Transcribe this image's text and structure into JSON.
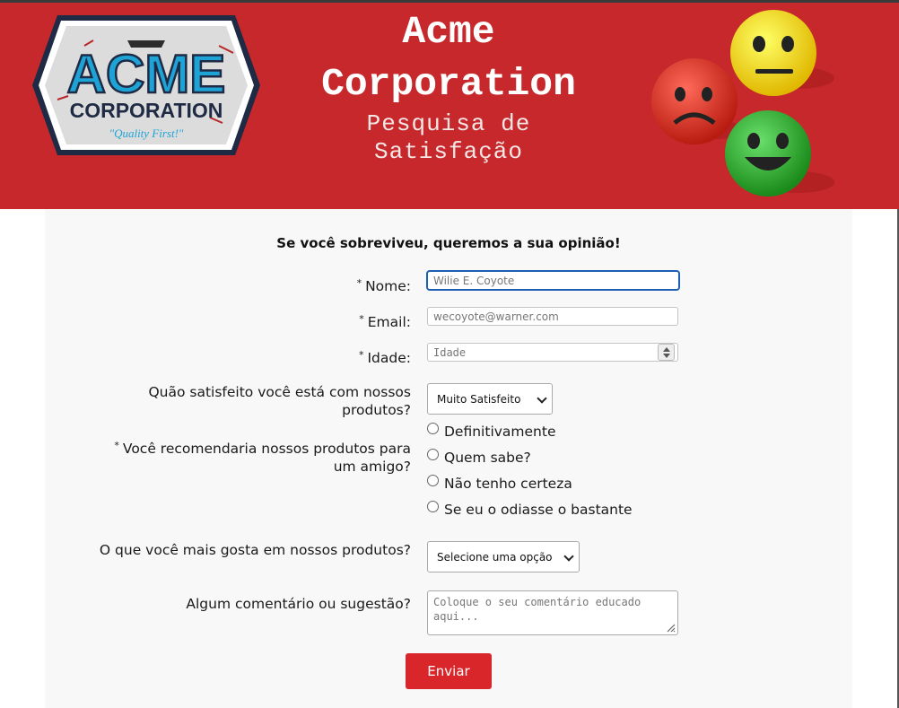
{
  "header": {
    "title_line1": "Acme",
    "title_line2": "Corporation",
    "subtitle_line1": "Pesquisa de",
    "subtitle_line2": "Satisfação",
    "logo": {
      "line1": "ACME",
      "line2": "CORPORATION",
      "tagline": "\"Quality First!\""
    },
    "colors": {
      "header_bg": "#c6282b",
      "button": "#d9262b",
      "focus": "#1d5fb5"
    }
  },
  "form": {
    "heading": "Se você sobreviveu, queremos a sua opinião!",
    "required_mark": "*",
    "name": {
      "label": "Nome:",
      "placeholder": "Wilie E. Coyote"
    },
    "email": {
      "label": "Email:",
      "placeholder": "wecoyote@warner.com"
    },
    "age": {
      "label": "Idade:",
      "placeholder": "Idade"
    },
    "satisfaction": {
      "label_line1": "Quão satisfeito você está com nossos",
      "label_line2": "produtos?",
      "selected": "Muito Satisfeito"
    },
    "recommend": {
      "label_line1": "Você recomendaria nossos produtos para",
      "label_line2": "um amigo?",
      "options": [
        "Definitivamente",
        "Quem sabe?",
        "Não tenho certeza",
        "Se eu o odiasse o bastante"
      ]
    },
    "likes": {
      "label": "O que você mais gosta em nossos produtos?",
      "selected": "Selecione uma opção"
    },
    "comments": {
      "label": "Algum comentário ou sugestão?",
      "placeholder": "Coloque o seu comentário educado aqui..."
    },
    "submit_label": "Enviar"
  }
}
